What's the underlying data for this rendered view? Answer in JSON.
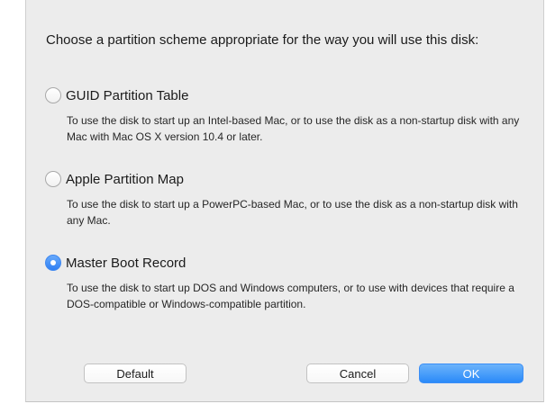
{
  "dialog": {
    "prompt": "Choose a partition scheme appropriate for the way you will use this disk:",
    "options": [
      {
        "label": "GUID Partition Table",
        "description": "To use the disk to start up an Intel-based Mac, or to use the disk as a non-startup disk with any Mac with Mac OS X version 10.4 or later.",
        "selected": false
      },
      {
        "label": "Apple Partition Map",
        "description": "To use the disk to start up a PowerPC-based Mac, or to use the disk as a non-startup disk with any Mac.",
        "selected": false
      },
      {
        "label": "Master Boot Record",
        "description": "To use the disk to start up DOS and Windows computers, or to use with devices that require a DOS-compatible or Windows-compatible partition.",
        "selected": true
      }
    ],
    "buttons": {
      "default_label": "Default",
      "cancel_label": "Cancel",
      "ok_label": "OK"
    },
    "colors": {
      "accent": "#3a8cf6",
      "background": "#ececec"
    }
  }
}
